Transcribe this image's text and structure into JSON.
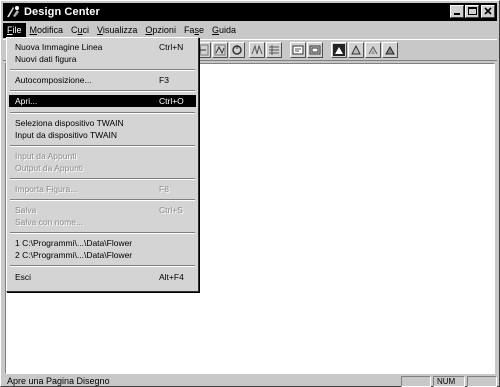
{
  "window": {
    "title": "Design Center"
  },
  "menubar": [
    {
      "label": "File",
      "ul": "F",
      "rest": "ile",
      "open": true
    },
    {
      "label": "Modifica",
      "ul": "M",
      "rest": "odifica"
    },
    {
      "label": "Cuci",
      "pre": "C",
      "ul": "u",
      "rest": "ci"
    },
    {
      "label": "Visualizza",
      "ul": "V",
      "rest": "isualizza"
    },
    {
      "label": "Opzioni",
      "ul": "O",
      "rest": "pzioni"
    },
    {
      "label": "Fase",
      "pre": "Fa",
      "ul": "s",
      "rest": "e"
    },
    {
      "label": "Guida",
      "ul": "G",
      "rest": "uida"
    }
  ],
  "file_menu": {
    "items": [
      {
        "label": "Nuova Immagine Linea",
        "accel": "Ctrl+N",
        "state": "normal"
      },
      {
        "label": "Nuovi dati figura",
        "accel": "",
        "state": "normal"
      },
      {
        "label": "Autocomposizione...",
        "accel": "F3",
        "state": "normal"
      },
      {
        "label": "Apri...",
        "accel": "Ctrl+O",
        "state": "selected"
      },
      {
        "label": "Seleziona dispositivo TWAIN",
        "accel": "",
        "state": "normal"
      },
      {
        "label": "Input da dispositivo TWAIN",
        "accel": "",
        "state": "normal"
      },
      {
        "label": "Input da Appunti",
        "accel": "",
        "state": "disabled"
      },
      {
        "label": "Output da Appunti",
        "accel": "",
        "state": "disabled"
      },
      {
        "label": "Importa Figura...",
        "accel": "F8",
        "state": "disabled"
      },
      {
        "label": "Salva",
        "accel": "Ctrl+S",
        "state": "disabled"
      },
      {
        "label": "Salva con nome...",
        "accel": "",
        "state": "disabled"
      },
      {
        "label": "1 C:\\Programmi\\...\\Data\\Flower",
        "accel": "",
        "state": "normal"
      },
      {
        "label": "2 C:\\Programmi\\...\\Data\\Flower",
        "accel": "",
        "state": "normal"
      },
      {
        "label": "Esci",
        "accel": "Alt+F4",
        "state": "normal"
      }
    ]
  },
  "toolbar": {
    "icons": [
      "new-icon",
      "open-icon",
      "save-icon",
      "print-icon",
      "tool-a-icon",
      "tool-b-icon",
      "tool-c-icon",
      "rotate-icon",
      "stitch-a-icon",
      "stitch-b-icon",
      "view-a-icon",
      "view-b-icon",
      "mode-a-icon",
      "mode-b-icon",
      "mode-c-icon",
      "mode-d-icon"
    ]
  },
  "statusbar": {
    "text": "Apre una Pagina Disegno",
    "num": "NUM"
  },
  "colors": {
    "titlebar": "#000000",
    "selection": "#000000",
    "client": "#ffffff",
    "chrome": "#d4d4d4"
  }
}
